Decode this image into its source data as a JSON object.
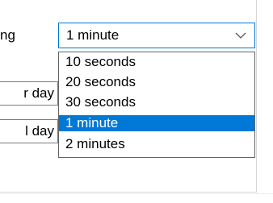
{
  "form": {
    "label_fragment": "ng",
    "side_field_1": "r day",
    "side_field_2": "l day"
  },
  "interval_combo": {
    "value": "1 minute",
    "icon": "chevron-down-icon",
    "accent_color": "#0078d7"
  },
  "interval_dropdown": {
    "selected_index": 3,
    "options": [
      {
        "label": "10 seconds"
      },
      {
        "label": "20 seconds"
      },
      {
        "label": "30 seconds"
      },
      {
        "label": "1 minute"
      },
      {
        "label": "2 minutes"
      }
    ]
  }
}
